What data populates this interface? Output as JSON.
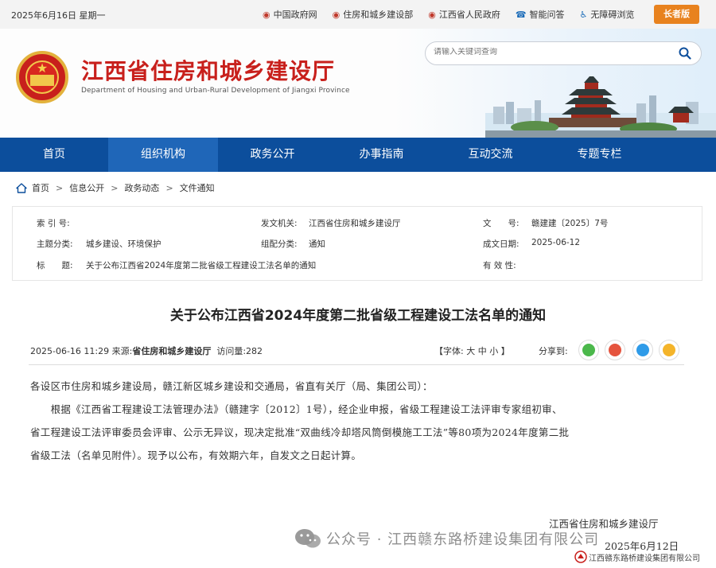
{
  "topbar": {
    "date": "2025年6月16日 星期一",
    "links": [
      {
        "label": "中国政府网",
        "icon": "emblem-icon"
      },
      {
        "label": "住房和城乡建设部",
        "icon": "emblem-icon"
      },
      {
        "label": "江西省人民政府",
        "icon": "emblem-icon"
      },
      {
        "label": "智能问答",
        "icon": "headset-icon"
      },
      {
        "label": "无障碍浏览",
        "icon": "accessibility-icon"
      }
    ],
    "elder_mode": "长者版"
  },
  "header": {
    "title": "江西省住房和城乡建设厅",
    "subtitle": "Department of Housing and Urban-Rural Development of Jiangxi Province",
    "search_placeholder": "请输入关键词查询"
  },
  "nav": {
    "items": [
      "首页",
      "组织机构",
      "政务公开",
      "办事指南",
      "互动交流",
      "专题专栏"
    ],
    "active_index": 1
  },
  "breadcrumb": [
    "首页",
    "信息公开",
    "政务动态",
    "文件通知"
  ],
  "meta": {
    "index_label": "索 引 号:",
    "index_value": "",
    "issuer_label": "发文机关:",
    "issuer_value": "江西省住房和城乡建设厅",
    "docno_label": "文　　号:",
    "docno_value": "赣建建〔2025〕7号",
    "topic_label": "主题分类:",
    "topic_value": "城乡建设、环境保护",
    "style_label": "组配分类:",
    "style_value": "通知",
    "date_label": "成文日期:",
    "date_value": "2025-06-12",
    "title_label": "标　　题:",
    "title_value": "关于公布江西省2024年度第二批省级工程建设工法名单的通知",
    "validity_label": "有 效 性:",
    "validity_value": ""
  },
  "article": {
    "title": "关于公布江西省2024年度第二批省级工程建设工法名单的通知",
    "datetime": "2025-06-16 11:29",
    "source_label": "来源:",
    "source_value": "省住房和城乡建设厅",
    "views": "访问量:282",
    "font_size_label": "【字体: 大 中 小 】",
    "share_label": "分享到:",
    "paragraphs": [
      "各设区市住房和城乡建设局，赣江新区城乡建设和交通局，省直有关厅（局、集团公司）：",
      "　　根据《江西省工程建设工法管理办法》（赣建字〔2012〕1号），经企业申报，省级工程建设工法评审专家组初审、",
      "省工程建设工法评审委员会评审、公示无异议，现决定批准“双曲线冷却塔风筒倒模施工工法”等80项为2024年度第二批",
      "省级工法（名单见附件）。现予以公布，有效期六年，自发文之日起计算。"
    ],
    "signature": "江西省住房和城乡建设厅",
    "sign_date": "2025年6月12日"
  },
  "watermark": {
    "text": "公众号 · 江西赣东路桥建设集团有限公司",
    "company": "江西赣东路桥建设集团有限公司"
  },
  "colors": {
    "brand_red": "#c8201c",
    "nav_blue": "#0c4e9c",
    "nav_active": "#1f66b8",
    "elder_orange": "#e8821e"
  }
}
